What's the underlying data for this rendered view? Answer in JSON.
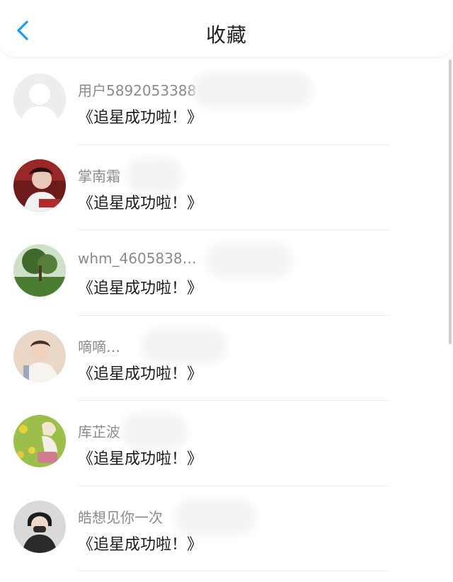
{
  "header": {
    "title": "收藏",
    "back_icon": "chevron-left-icon",
    "accent": "#2196f3"
  },
  "items": [
    {
      "name": "用户5892053388",
      "content": "《追星成功啦！》",
      "avatar": "default-avatar"
    },
    {
      "name": "掌南霜",
      "content": "《追星成功啦！》",
      "avatar": "user-avatar"
    },
    {
      "name": "whm_4605838…",
      "content": "《追星成功啦！》",
      "avatar": "user-avatar"
    },
    {
      "name": "嘀嘀…",
      "content": "《追星成功啦！》",
      "avatar": "user-avatar"
    },
    {
      "name": "库芷波",
      "content": "《追星成功啦！》",
      "avatar": "user-avatar"
    },
    {
      "name": "皓想见你一次",
      "content": "《追星成功啦！》",
      "avatar": "user-avatar"
    }
  ]
}
